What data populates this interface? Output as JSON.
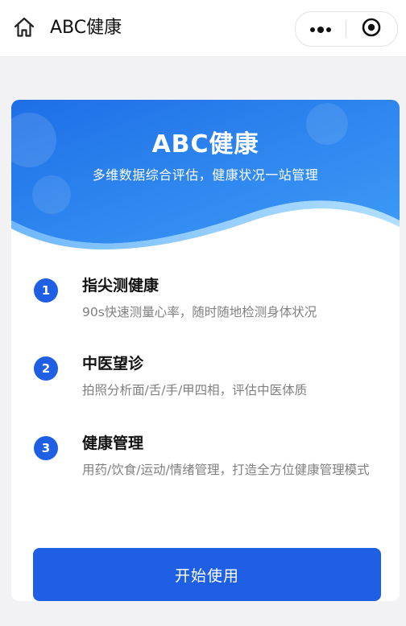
{
  "navbar": {
    "home_icon": "home-icon",
    "title": "ABC健康",
    "more_icon": "more-dots-icon",
    "close_icon": "target-circle-icon"
  },
  "banner": {
    "title": "ABC健康",
    "subtitle": "多维数据综合评估，健康状况一站管理",
    "colors": {
      "gradient_start": "#1e6fe6",
      "gradient_end": "#3e9cf7"
    }
  },
  "features": [
    {
      "number": "1",
      "title": "指尖测健康",
      "description": "90s快速测量心率，随时随地检测身体状况"
    },
    {
      "number": "2",
      "title": "中医望诊",
      "description": "拍照分析面/舌/手/甲四相，评估中医体质"
    },
    {
      "number": "3",
      "title": "健康管理",
      "description": "用药/饮食/运动/情绪管理，打造全方位健康管理模式"
    }
  ],
  "start_button": {
    "label": "开始使用"
  },
  "colors": {
    "accent": "#1f5fe3",
    "page_background": "#f2f2f4",
    "description_text": "#808080"
  }
}
